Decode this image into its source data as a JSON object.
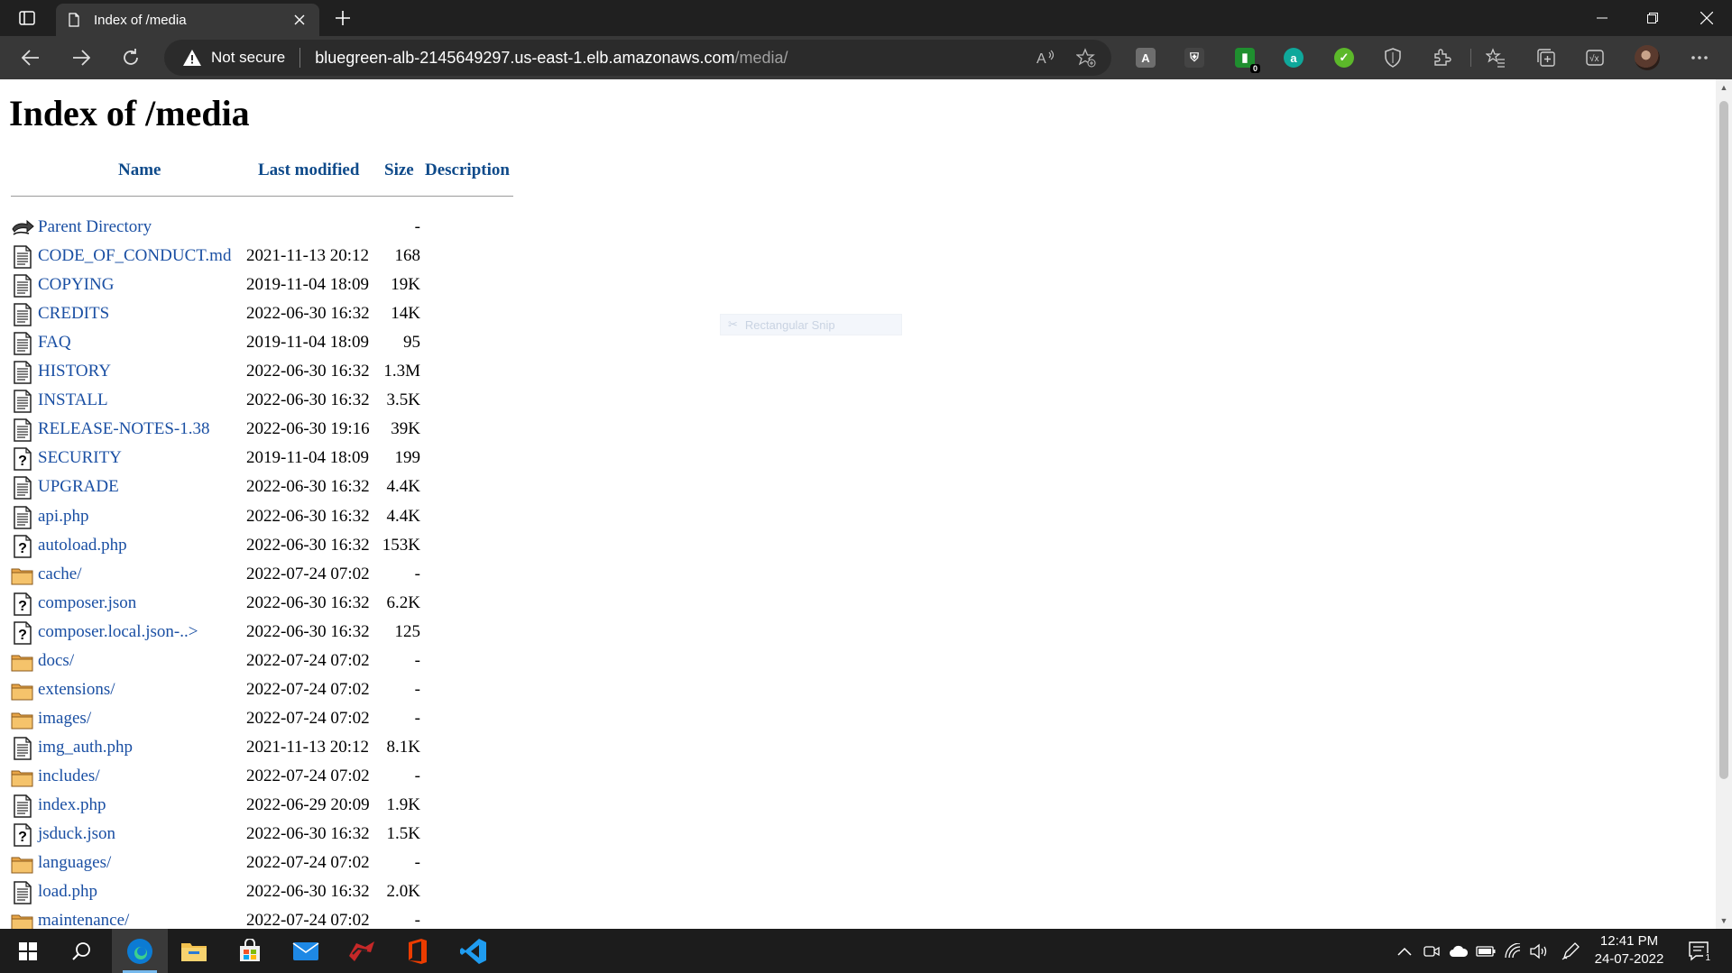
{
  "browser": {
    "tab_title": "Index of /media",
    "security_label": "Not secure",
    "url_host": "bluegreen-alb-2145649297.us-east-1.elb.amazonaws.com",
    "url_path": "/media/",
    "extension_badge_count": "0",
    "accent_color": "#202020"
  },
  "page": {
    "title": "Index of /media",
    "columns": {
      "name": "Name",
      "last_modified": "Last modified",
      "size": "Size",
      "description": "Description"
    },
    "entries": [
      {
        "name": "Parent Directory",
        "date": "",
        "size": "-",
        "icon": "back-icon"
      },
      {
        "name": "CODE_OF_CONDUCT.md",
        "date": "2021-11-13 20:12",
        "size": "168",
        "icon": "text-file-icon"
      },
      {
        "name": "COPYING",
        "date": "2019-11-04 18:09",
        "size": "19K",
        "icon": "text-file-icon"
      },
      {
        "name": "CREDITS",
        "date": "2022-06-30 16:32",
        "size": "14K",
        "icon": "text-file-icon"
      },
      {
        "name": "FAQ",
        "date": "2019-11-04 18:09",
        "size": "95",
        "icon": "text-file-icon"
      },
      {
        "name": "HISTORY",
        "date": "2022-06-30 16:32",
        "size": "1.3M",
        "icon": "text-file-icon"
      },
      {
        "name": "INSTALL",
        "date": "2022-06-30 16:32",
        "size": "3.5K",
        "icon": "text-file-icon"
      },
      {
        "name": "RELEASE-NOTES-1.38",
        "date": "2022-06-30 19:16",
        "size": "39K",
        "icon": "text-file-icon"
      },
      {
        "name": "SECURITY",
        "date": "2019-11-04 18:09",
        "size": "199",
        "icon": "unknown-file-icon"
      },
      {
        "name": "UPGRADE",
        "date": "2022-06-30 16:32",
        "size": "4.4K",
        "icon": "text-file-icon"
      },
      {
        "name": "api.php",
        "date": "2022-06-30 16:32",
        "size": "4.4K",
        "icon": "text-file-icon"
      },
      {
        "name": "autoload.php",
        "date": "2022-06-30 16:32",
        "size": "153K",
        "icon": "unknown-file-icon"
      },
      {
        "name": "cache/",
        "date": "2022-07-24 07:02",
        "size": "-",
        "icon": "folder-icon"
      },
      {
        "name": "composer.json",
        "date": "2022-06-30 16:32",
        "size": "6.2K",
        "icon": "unknown-file-icon"
      },
      {
        "name": "composer.local.json-..>",
        "date": "2022-06-30 16:32",
        "size": "125",
        "icon": "unknown-file-icon"
      },
      {
        "name": "docs/",
        "date": "2022-07-24 07:02",
        "size": "-",
        "icon": "folder-icon"
      },
      {
        "name": "extensions/",
        "date": "2022-07-24 07:02",
        "size": "-",
        "icon": "folder-icon"
      },
      {
        "name": "images/",
        "date": "2022-07-24 07:02",
        "size": "-",
        "icon": "folder-icon"
      },
      {
        "name": "img_auth.php",
        "date": "2021-11-13 20:12",
        "size": "8.1K",
        "icon": "text-file-icon"
      },
      {
        "name": "includes/",
        "date": "2022-07-24 07:02",
        "size": "-",
        "icon": "folder-icon"
      },
      {
        "name": "index.php",
        "date": "2022-06-29 20:09",
        "size": "1.9K",
        "icon": "text-file-icon"
      },
      {
        "name": "jsduck.json",
        "date": "2022-06-30 16:32",
        "size": "1.5K",
        "icon": "unknown-file-icon"
      },
      {
        "name": "languages/",
        "date": "2022-07-24 07:02",
        "size": "-",
        "icon": "folder-icon"
      },
      {
        "name": "load.php",
        "date": "2022-06-30 16:32",
        "size": "2.0K",
        "icon": "text-file-icon"
      },
      {
        "name": "maintenance/",
        "date": "2022-07-24 07:02",
        "size": "-",
        "icon": "folder-icon"
      }
    ],
    "snip_overlay_text": "Rectangular Snip",
    "link_color": "#1a4fa3",
    "header_color": "#0e4a8a"
  },
  "taskbar": {
    "time": "12:41 PM",
    "date": "24-07-2022",
    "notification_count": "1"
  }
}
